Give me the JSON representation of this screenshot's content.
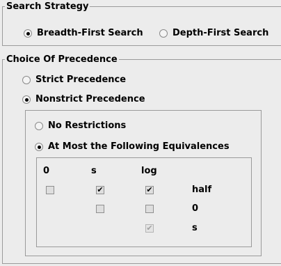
{
  "search_strategy": {
    "title": "Search Strategy",
    "options": [
      {
        "label": "Breadth-First Search",
        "selected": true
      },
      {
        "label": "Depth-First Search",
        "selected": false
      }
    ]
  },
  "precedence": {
    "title": "Choice Of Precedence",
    "options": [
      {
        "label": "Strict Precedence",
        "selected": false
      },
      {
        "label": "Nonstrict Precedence",
        "selected": true
      }
    ],
    "nonstrict": {
      "options": [
        {
          "label": "No Restrictions",
          "selected": false
        },
        {
          "label": "At Most the Following Equivalences",
          "selected": true
        }
      ],
      "columns": [
        "0",
        "s",
        "log"
      ],
      "row_labels": [
        "half",
        "0",
        "s"
      ],
      "check_glyph": "✔"
    }
  }
}
